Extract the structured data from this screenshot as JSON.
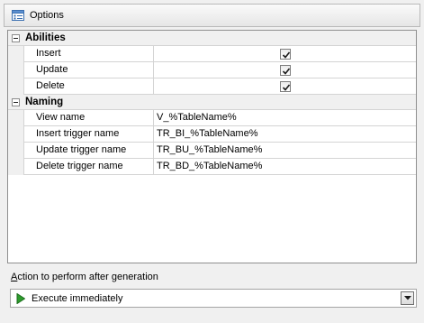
{
  "header": {
    "title": "Options",
    "icon": "options-panel-icon"
  },
  "abilities": {
    "label": "Abilities",
    "rows": [
      {
        "name": "Insert",
        "checked": true
      },
      {
        "name": "Update",
        "checked": true
      },
      {
        "name": "Delete",
        "checked": true
      }
    ]
  },
  "naming": {
    "label": "Naming",
    "rows": [
      {
        "name": "View name",
        "value": "V_%TableName%"
      },
      {
        "name": "Insert trigger name",
        "value": "TR_BI_%TableName%"
      },
      {
        "name": "Update trigger name",
        "value": "TR_BU_%TableName%"
      },
      {
        "name": "Delete trigger name",
        "value": "TR_BD_%TableName%"
      }
    ]
  },
  "action": {
    "label_accel": "A",
    "label_rest": "ction to perform after generation",
    "selected": "Execute immediately",
    "icon": "play-icon"
  },
  "colors": {
    "check": "#1a1a1a",
    "play": "#2d9b2d"
  }
}
